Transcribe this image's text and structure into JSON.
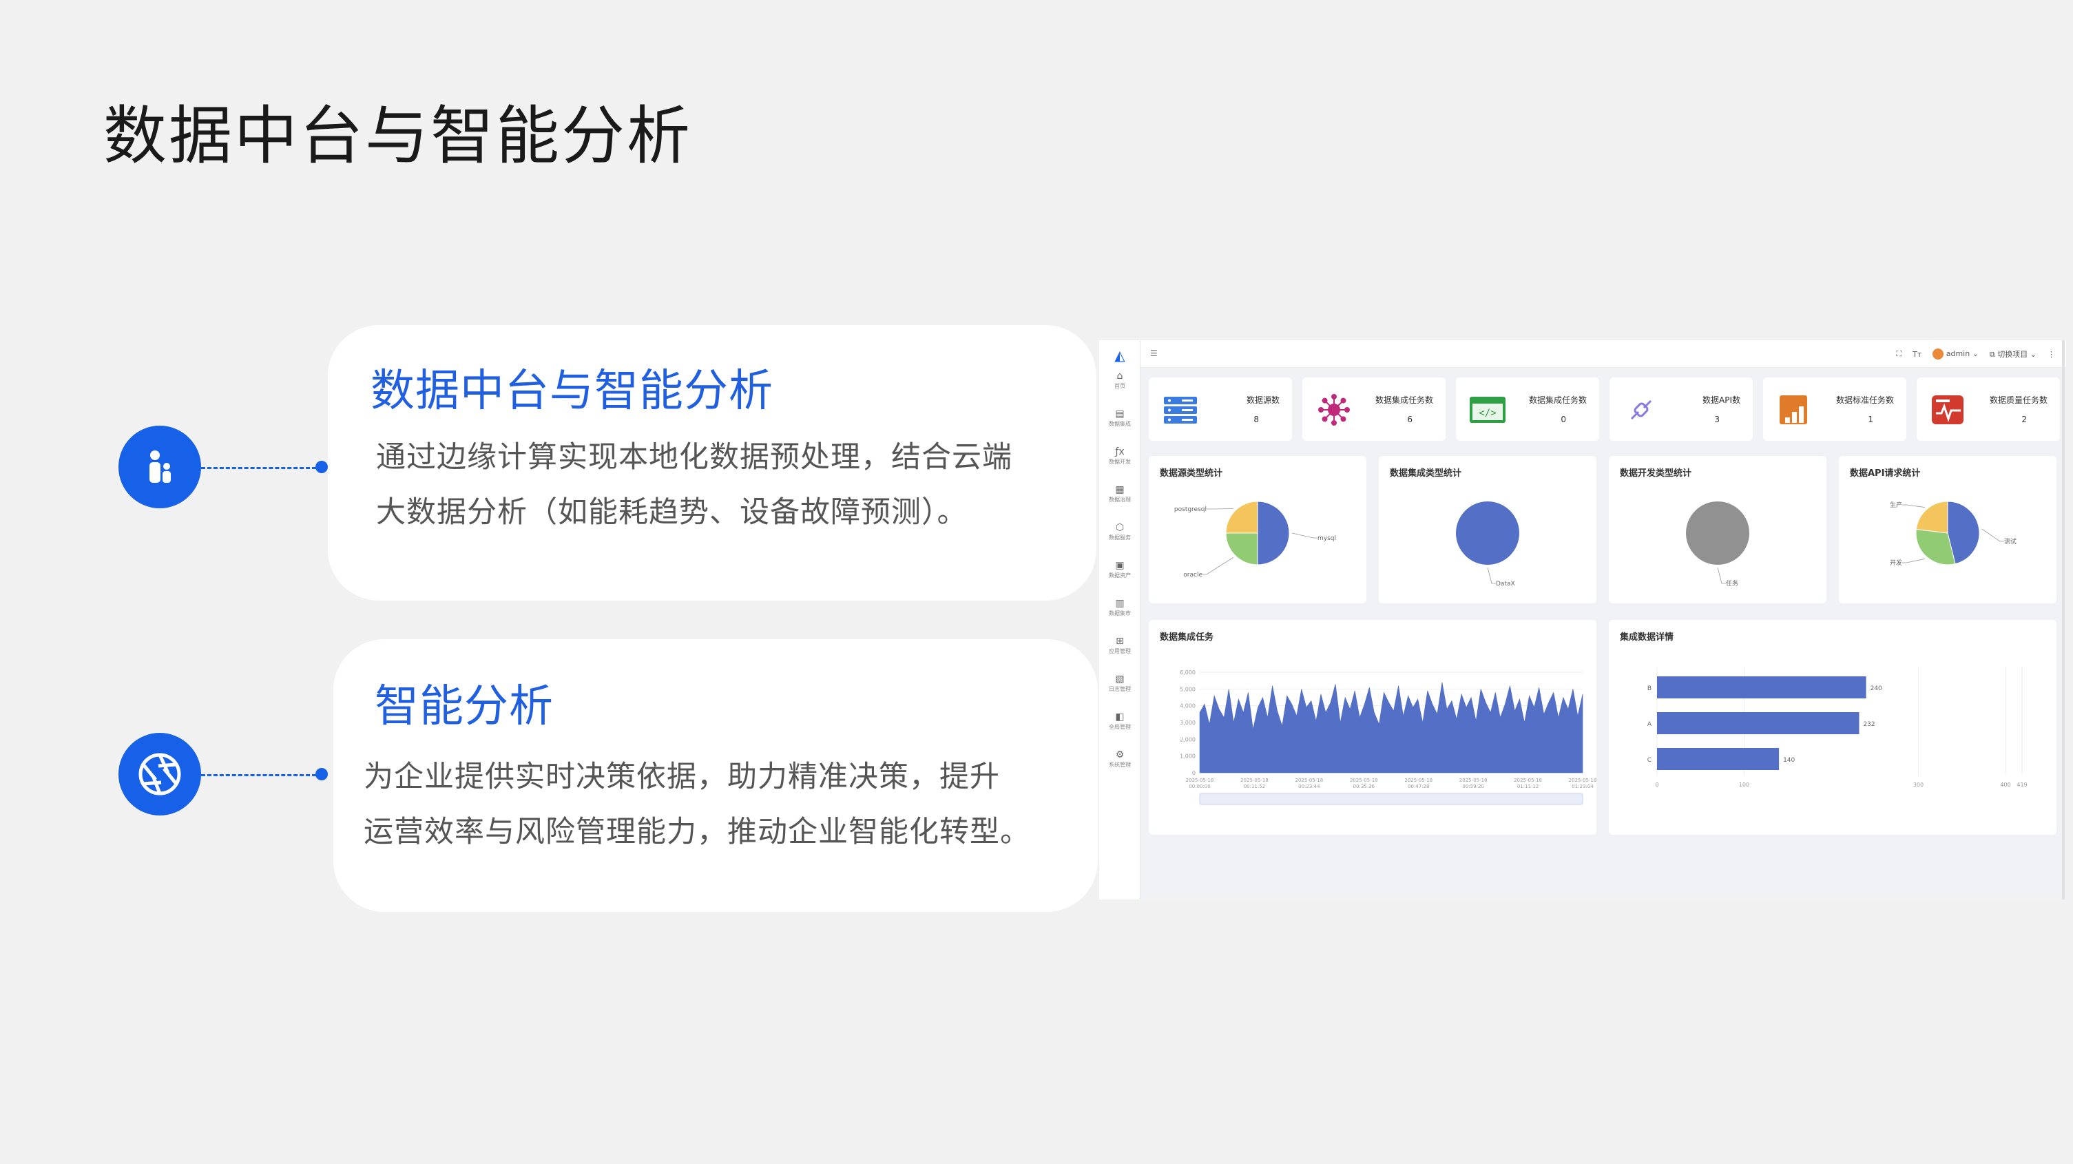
{
  "slide": {
    "title": "数据中台与智能分析"
  },
  "features": [
    {
      "title": "数据中台与智能分析",
      "lines": [
        "通过边缘计算实现本地化数据预处理，结合云端",
        "大数据分析（如能耗趋势、设备故障预测）。"
      ],
      "icon": "people-icon"
    },
    {
      "title": "智能分析",
      "lines": [
        "为企业提供实时决策依据，助力精准决策，提升",
        "运营效率与风险管理能力，推动企业智能化转型。"
      ],
      "icon": "aperture-icon"
    }
  ],
  "dashboard": {
    "topbar": {
      "user": "admin",
      "project": "切换项目"
    },
    "sidebar": [
      "首页",
      "数据集成",
      "数据开发",
      "数据治理",
      "数据服务",
      "数据资产",
      "数据集市",
      "应用管理",
      "日志管理",
      "全局管理",
      "系统管理"
    ],
    "stats": [
      {
        "label": "数据源数",
        "value": "8",
        "icon": "server-icon",
        "color": "#3b7be0"
      },
      {
        "label": "数据集成任务数",
        "value": "6",
        "icon": "network-icon",
        "color": "#c0287a"
      },
      {
        "label": "数据集成任务数",
        "value": "0",
        "icon": "code-window-icon",
        "color": "#2f9e44"
      },
      {
        "label": "数据API数",
        "value": "3",
        "icon": "plug-icon",
        "color": "#8a7ae0"
      },
      {
        "label": "数据标准任务数",
        "value": "1",
        "icon": "book-chart-icon",
        "color": "#e07b2a"
      },
      {
        "label": "数据质量任务数",
        "value": "2",
        "icon": "report-icon",
        "color": "#d23a2e"
      }
    ],
    "colors": {
      "blue": "#5470c6",
      "yellow": "#f3c55c",
      "green": "#91cc75",
      "gray": "#919191"
    }
  },
  "chart_data": [
    {
      "type": "pie",
      "title": "数据源类型统计",
      "categories": [
        "mysql",
        "oracle",
        "postgresql"
      ],
      "values": [
        4,
        2,
        2
      ]
    },
    {
      "type": "pie",
      "title": "数据集成类型统计",
      "categories": [
        "DataX"
      ],
      "values": [
        6
      ]
    },
    {
      "type": "pie",
      "title": "数据开发类型统计",
      "categories": [
        "任务"
      ],
      "values": [
        1
      ]
    },
    {
      "type": "pie",
      "title": "数据API请求统计",
      "categories": [
        "测试",
        "开发",
        "生产"
      ],
      "values": [
        3,
        2,
        1.5
      ]
    },
    {
      "type": "area",
      "title": "数据集成任务",
      "ylim": [
        0,
        6000
      ],
      "y_ticks": [
        "0",
        "1,000",
        "2,000",
        "3,000",
        "4,000",
        "5,000",
        "6,000"
      ],
      "x_ticks": [
        "2025-05-18 00:00:00",
        "2025-05-18 00:11:52",
        "2025-05-18 00:23:44",
        "2025-05-18 00:35:36",
        "2025-05-18 00:47:28",
        "2025-05-18 00:59:20",
        "2025-05-18 01:11:12",
        "2025-05-18 01:23:04"
      ],
      "series": [
        {
          "values": [
            3600,
            4100,
            2900,
            4600,
            3800,
            3300,
            5000,
            3000,
            4400,
            3600,
            4800,
            2600,
            3900,
            4500,
            3300,
            5200,
            3700,
            2800,
            4600,
            4100,
            3400,
            5000,
            3900,
            4300,
            3100,
            4700,
            3600,
            4200,
            5300,
            3000,
            4500,
            3800,
            4900,
            3300,
            4100,
            5100,
            3600,
            2900,
            4800,
            4200,
            3700,
            5200,
            3400,
            4600,
            3900,
            4400,
            3000,
            4900,
            4100,
            3500,
            5400,
            3800,
            4300,
            3200,
            4700,
            3900,
            4500,
            3100,
            5000,
            4200,
            3600,
            4800,
            3300,
            4100,
            5200,
            3700,
            4400,
            3000,
            4600,
            3900,
            5100,
            3500,
            4200,
            4800,
            3300,
            4500,
            3800,
            5000,
            3400,
            4700
          ]
        }
      ]
    },
    {
      "type": "bar",
      "title": "集成数据详情",
      "orientation": "horizontal",
      "categories": [
        "B",
        "A",
        "C"
      ],
      "values": [
        240,
        232,
        140
      ],
      "x_ticks": [
        "0",
        "100",
        "300",
        "400",
        "419"
      ],
      "xlim": [
        0,
        419
      ]
    }
  ]
}
